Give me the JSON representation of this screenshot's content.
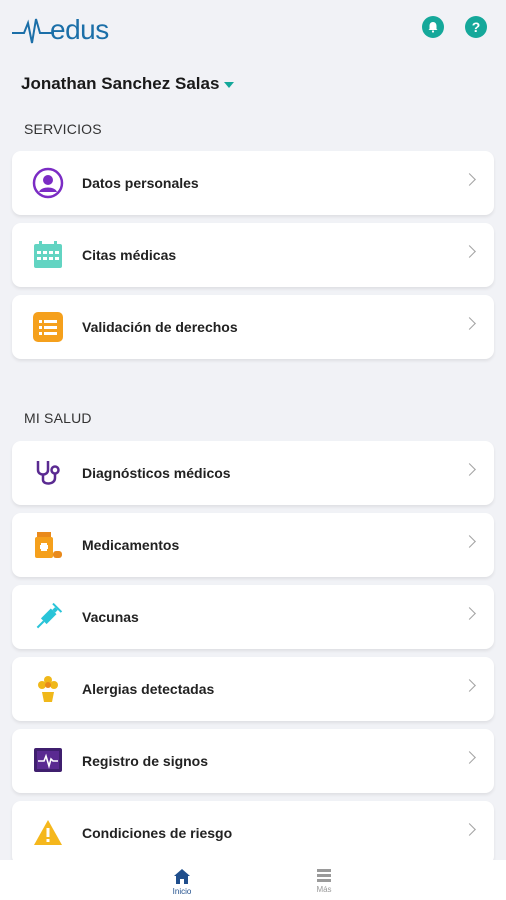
{
  "app": {
    "logo_text": "edus",
    "brand_color": "#1b6fa8",
    "accent": "#14a89a"
  },
  "header": {
    "bell_icon": "bell-icon",
    "help_icon": "help-icon",
    "help_glyph": "?"
  },
  "user": {
    "name": "Jonathan Sanchez Salas"
  },
  "servicios": {
    "title": "SERVICIOS",
    "items": [
      {
        "label": "Datos personales",
        "icon": "user-icon"
      },
      {
        "label": "Citas médicas",
        "icon": "calendar-icon"
      },
      {
        "label": "Validación de derechos",
        "icon": "list-icon"
      }
    ]
  },
  "mi_salud": {
    "title": "MI SALUD",
    "items": [
      {
        "label": "Diagnósticos médicos",
        "icon": "stethoscope-icon"
      },
      {
        "label": "Medicamentos",
        "icon": "medicine-icon"
      },
      {
        "label": "Vacunas",
        "icon": "syringe-icon"
      },
      {
        "label": "Alergias detectadas",
        "icon": "flower-icon"
      },
      {
        "label": "Registro de signos",
        "icon": "heartbeat-monitor-icon"
      },
      {
        "label": "Condiciones de riesgo",
        "icon": "warning-icon"
      }
    ]
  },
  "bottom_nav": {
    "items": [
      {
        "label": "Inicio",
        "icon": "home-icon",
        "active": true
      },
      {
        "label": "Más",
        "icon": "menu-icon",
        "active": false
      }
    ]
  }
}
